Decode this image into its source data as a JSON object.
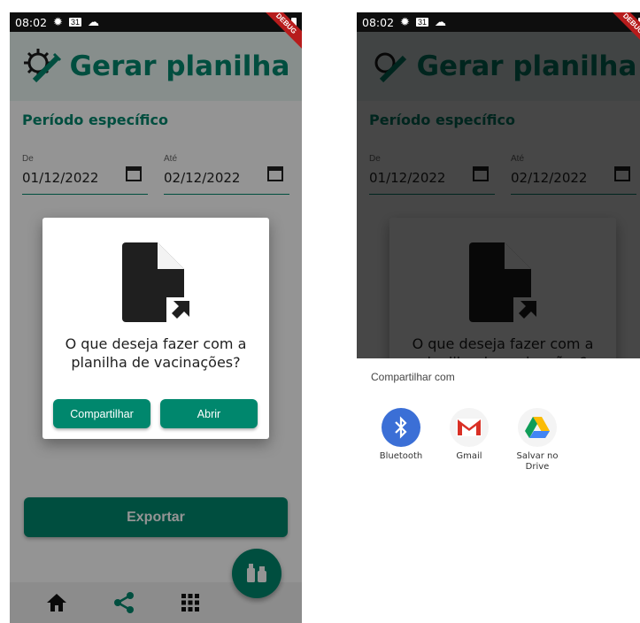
{
  "status": {
    "time": "08:02",
    "calendar_day": "31",
    "debug": "DEBUG"
  },
  "app": {
    "title": "Gerar planilha",
    "section_title": "Período específico"
  },
  "date_range": {
    "from": {
      "label": "De",
      "value": "01/12/2022"
    },
    "to": {
      "label": "Até",
      "value": "02/12/2022"
    }
  },
  "export_label": "Exportar",
  "dialog": {
    "question": "O que deseja fazer com a planilha de vacinações?",
    "share_label": "Compartilhar",
    "open_label": "Abrir"
  },
  "share_sheet": {
    "heading": "Compartilhar com",
    "targets": [
      {
        "name": "Bluetooth"
      },
      {
        "name": "Gmail"
      },
      {
        "name": "Salvar no Drive"
      }
    ]
  },
  "nav": {
    "items": [
      "home-icon",
      "share-icon",
      "apps-icon"
    ],
    "fab": "vaccine-icon"
  },
  "colors": {
    "primary": "#00876d",
    "appbar_bg": "#e8f5f2"
  }
}
